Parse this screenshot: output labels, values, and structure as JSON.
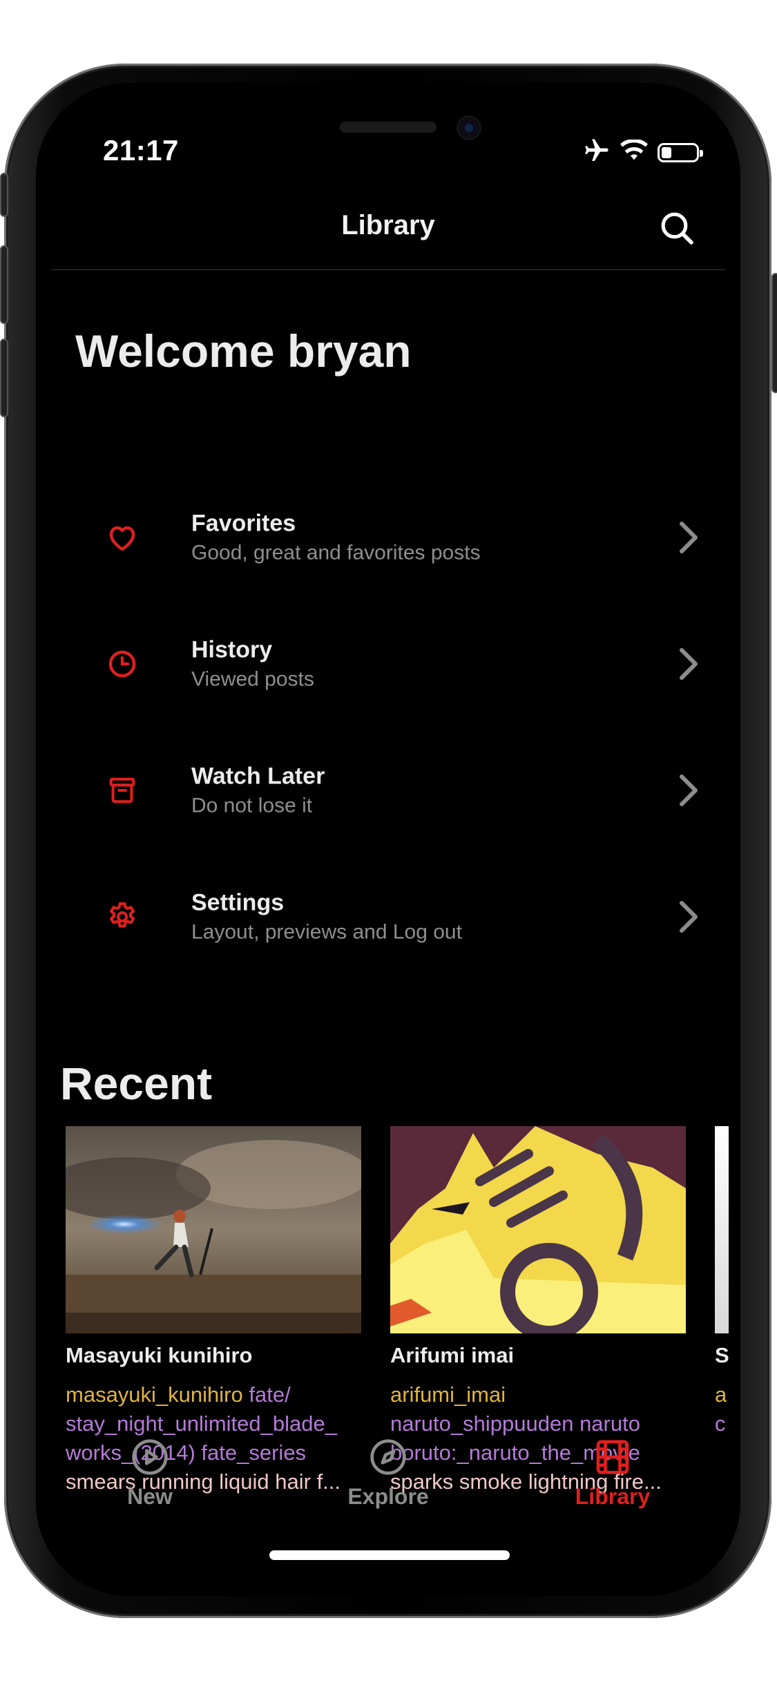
{
  "status_bar": {
    "time": "21:17",
    "battery_level": 0.3
  },
  "nav": {
    "title": "Library"
  },
  "welcome": "Welcome bryan",
  "menu": [
    {
      "title": "Favorites",
      "subtitle": "Good, great and favorites posts",
      "icon": "heart-icon"
    },
    {
      "title": "History",
      "subtitle": "Viewed posts",
      "icon": "clock-icon"
    },
    {
      "title": "Watch Later",
      "subtitle": "Do not lose it",
      "icon": "archive-box-icon"
    },
    {
      "title": "Settings",
      "subtitle": "Layout, previews and Log out",
      "icon": "gear-icon"
    }
  ],
  "recent": {
    "title": "Recent",
    "cards": [
      {
        "title": "Masayuki kunihiro",
        "artist": "masayuki_kunihiro",
        "copyright": "fate/ stay_night_unlimited_blade_ works_(2014) fate_series",
        "general": "smears running liquid hair f..."
      },
      {
        "title": "Arifumi imai",
        "artist": "arifumi_imai",
        "copyright": "naruto_shippuuden naruto boruto:_naruto_the_movie",
        "general": "sparks smoke lightning fire..."
      },
      {
        "title": "S",
        "artist": "a",
        "copyright": "c",
        "general": ""
      }
    ]
  },
  "tabs": [
    {
      "label": "New",
      "icon": "play-circle-icon",
      "active": false
    },
    {
      "label": "Explore",
      "icon": "compass-icon",
      "active": false
    },
    {
      "label": "Library",
      "icon": "film-strip-icon",
      "active": true
    }
  ],
  "colors": {
    "accent": "#e01f1f",
    "artist_tag": "#e0b43f",
    "copyright_tag": "#b57ad8",
    "general_tag": "#f0c8c8",
    "background": "#000000"
  }
}
